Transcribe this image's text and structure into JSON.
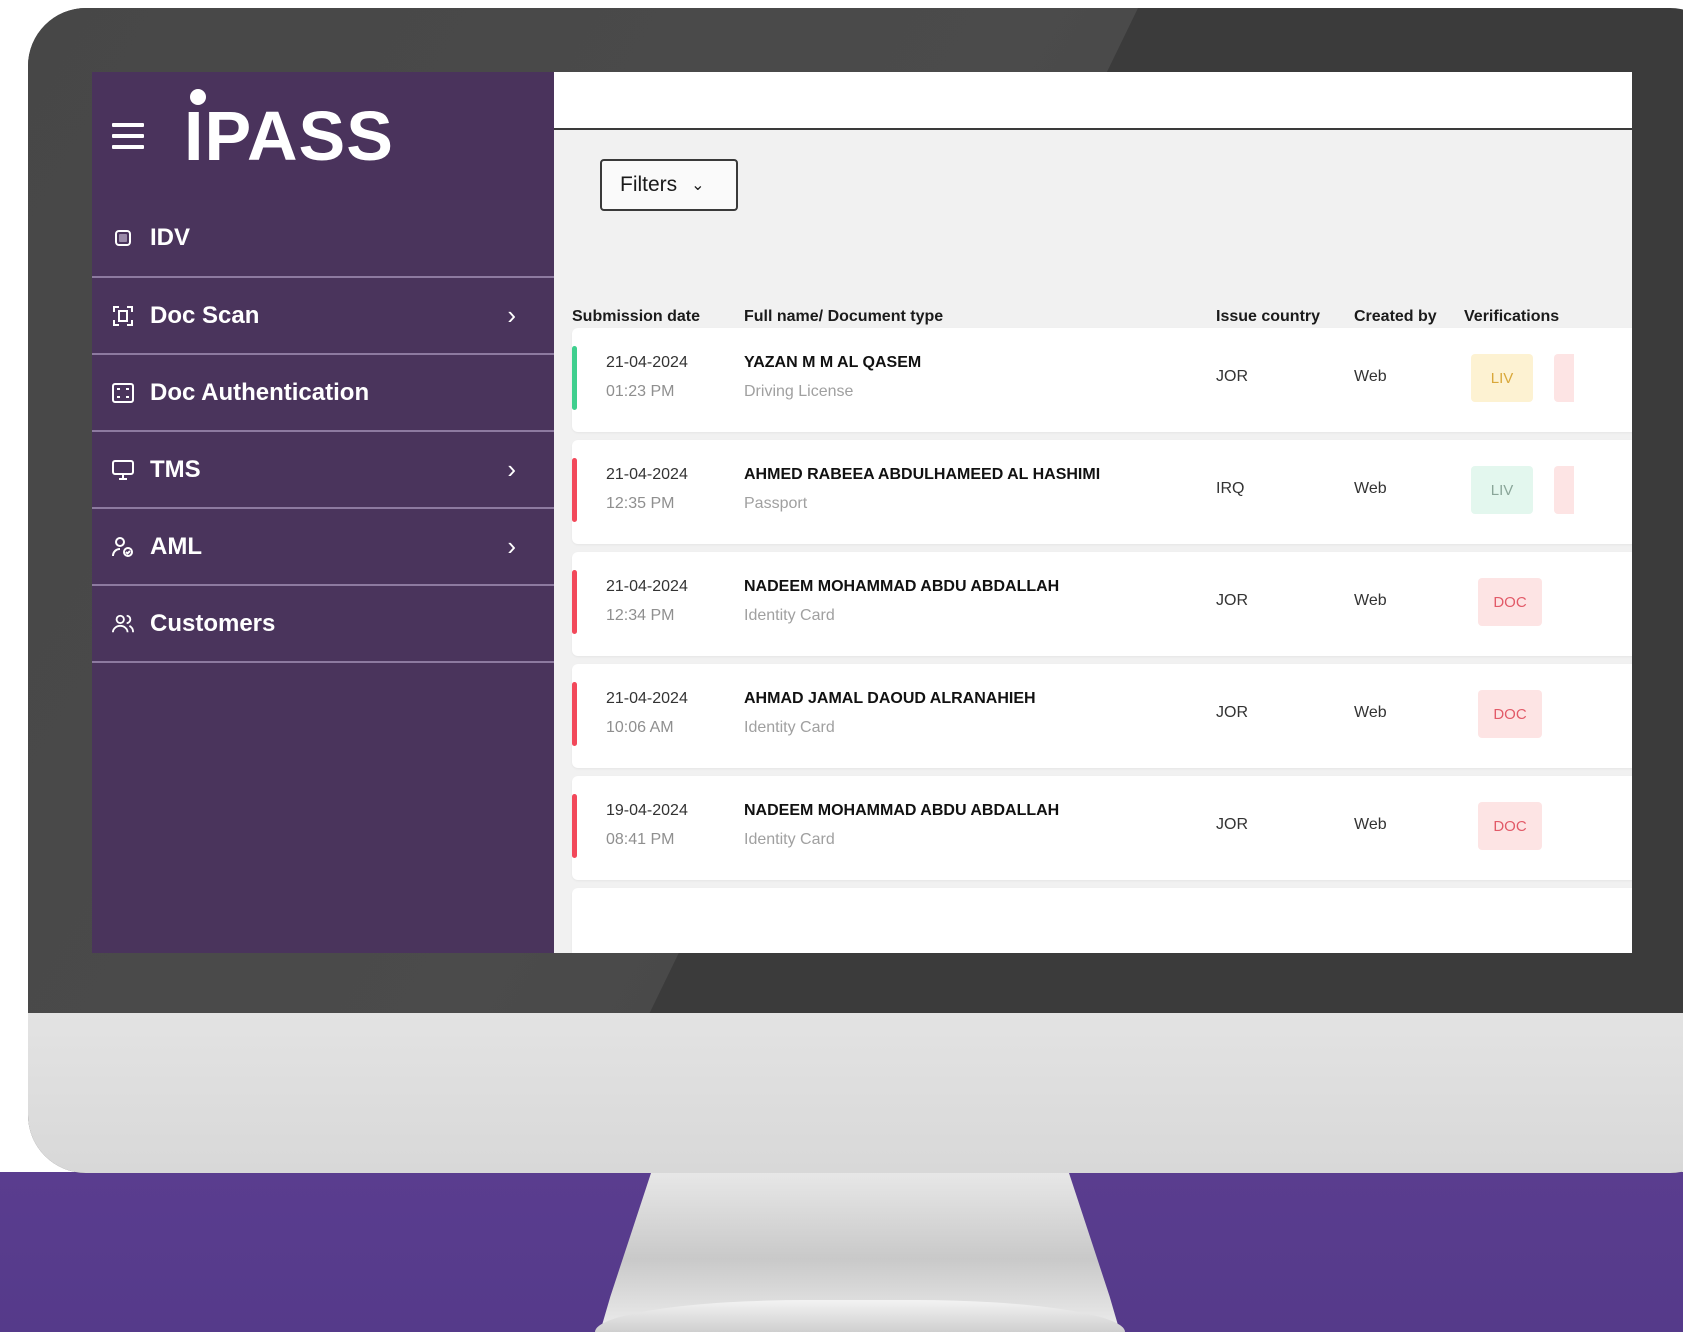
{
  "brand": {
    "logo_text": "PASS",
    "logo_i": "I"
  },
  "sidebar": {
    "items": [
      {
        "label": "IDV",
        "icon": "square-icon",
        "has_chevron": false
      },
      {
        "label": "Doc Scan",
        "icon": "scan-icon",
        "has_chevron": true
      },
      {
        "label": "Doc Authentication",
        "icon": "doc-auth-icon",
        "has_chevron": false
      },
      {
        "label": "TMS",
        "icon": "monitor-icon",
        "has_chevron": true
      },
      {
        "label": "AML",
        "icon": "user-check-icon",
        "has_chevron": true
      },
      {
        "label": "Customers",
        "icon": "users-icon",
        "has_chevron": false
      }
    ]
  },
  "toolbar": {
    "filters_label": "Filters"
  },
  "table": {
    "headers": {
      "submission_date": "Submission date",
      "full_name": "Full name/ Document type",
      "issue_country": "Issue country",
      "created_by": "Created by",
      "verifications": "Verifications"
    },
    "rows": [
      {
        "date": "21-04-2024",
        "time": "01:23 PM",
        "name": "YAZAN M M AL QASEM",
        "doc_type": "Driving License",
        "country": "JOR",
        "created_by": "Web",
        "badge": "LIV",
        "status_color": "#3fcf8e",
        "badge_bg": "#fdf2d2",
        "badge_fg": "#d9a83a",
        "peek_color": "#fde4e4"
      },
      {
        "date": "21-04-2024",
        "time": "12:35 PM",
        "name": "AHMED RABEEA ABDULHAMEED AL HASHIMI",
        "doc_type": "Passport",
        "country": "IRQ",
        "created_by": "Web",
        "badge": "LIV",
        "status_color": "#f2485a",
        "badge_bg": "#e3f7ee",
        "badge_fg": "#8aa699",
        "peek_color": "#fde4e4"
      },
      {
        "date": "21-04-2024",
        "time": "12:34 PM",
        "name": "NADEEM MOHAMMAD ABDU ABDALLAH",
        "doc_type": "Identity Card",
        "country": "JOR",
        "created_by": "Web",
        "badge": "DOC",
        "status_color": "#f2485a",
        "badge_bg": "#fde4e4",
        "badge_fg": "#e25a68"
      },
      {
        "date": "21-04-2024",
        "time": "10:06 AM",
        "name": "AHMAD JAMAL DAOUD ALRANAHIEH",
        "doc_type": "Identity Card",
        "country": "JOR",
        "created_by": "Web",
        "badge": "DOC",
        "status_color": "#f2485a",
        "badge_bg": "#fde4e4",
        "badge_fg": "#e25a68"
      },
      {
        "date": "19-04-2024",
        "time": "08:41 PM",
        "name": "NADEEM MOHAMMAD ABDU ABDALLAH",
        "doc_type": "Identity Card",
        "country": "JOR",
        "created_by": "Web",
        "badge": "DOC",
        "status_color": "#f2485a",
        "badge_bg": "#fde4e4",
        "badge_fg": "#e25a68"
      }
    ]
  }
}
